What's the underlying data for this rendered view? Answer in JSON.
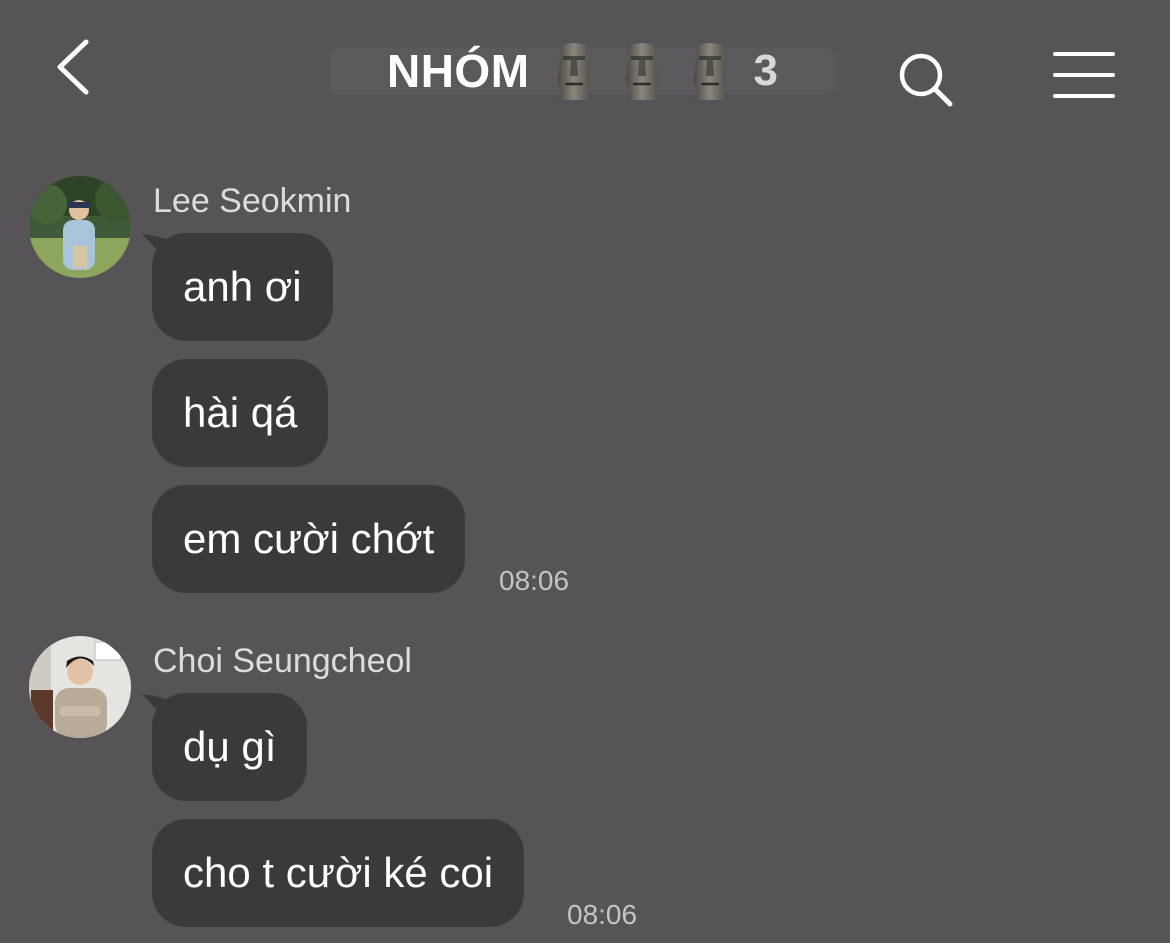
{
  "header": {
    "back_icon": "chevron-left-icon",
    "title": "NHÓM",
    "title_emoji": [
      "moai-icon",
      "moai-icon",
      "moai-icon"
    ],
    "member_count": "3",
    "search_icon": "search-icon",
    "menu_icon": "hamburger-menu-icon"
  },
  "messages": [
    {
      "sender": "Lee Seokmin",
      "lines": [
        "anh ơi",
        "hài qá",
        "em cười chớt"
      ],
      "time": "08:06"
    },
    {
      "sender": "Choi Seungcheol",
      "lines": [
        "dụ gì",
        "cho t cười ké coi"
      ],
      "time": "08:06"
    }
  ],
  "colors": {
    "background": "#565456",
    "bubble": "#3a393b",
    "text": "#ffffff",
    "secondary_text": "#dcdcdc"
  }
}
